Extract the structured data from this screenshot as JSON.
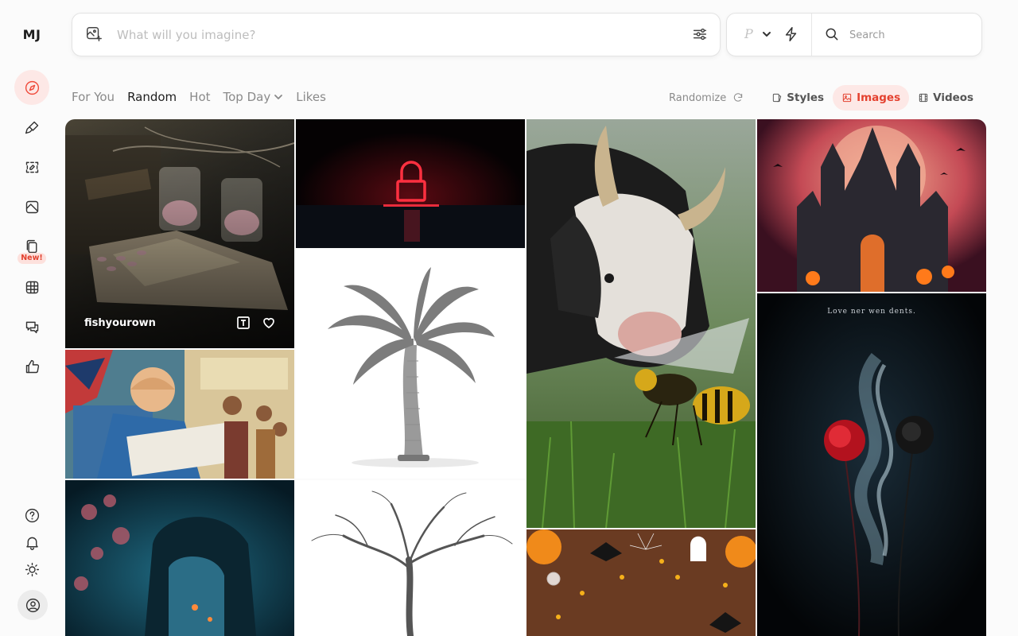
{
  "app": {
    "logo": "MJ"
  },
  "sidebar": {
    "items": [
      {
        "icon": "compass-icon",
        "active": true
      },
      {
        "icon": "paintbrush-icon"
      },
      {
        "icon": "edit-image-icon"
      },
      {
        "icon": "organize-icon"
      },
      {
        "icon": "personalize-icon",
        "badge": "New!"
      },
      {
        "icon": "grid-globe-icon"
      },
      {
        "icon": "chat-icon"
      },
      {
        "icon": "thumbs-up-icon"
      }
    ],
    "bottom": [
      "help-icon",
      "bell-icon",
      "sun-icon",
      "account-icon"
    ]
  },
  "prompt": {
    "placeholder": "What will you imagine?"
  },
  "tools": {
    "p_label": "P",
    "search_placeholder": "Search"
  },
  "tabs": [
    {
      "label": "For You"
    },
    {
      "label": "Random",
      "active": true
    },
    {
      "label": "Hot"
    },
    {
      "label": "Top Day",
      "dropdown": true
    },
    {
      "label": "Likes"
    }
  ],
  "controls": {
    "randomize": "Randomize",
    "styles": "Styles",
    "images": "Images",
    "videos": "Videos",
    "active": "Images"
  },
  "gallery": {
    "first_author": "fishyourown",
    "poster_text": "Love ner wen dents."
  },
  "colors": {
    "accent": "#ef4a3a",
    "accent_bg": "#fde8e6"
  }
}
